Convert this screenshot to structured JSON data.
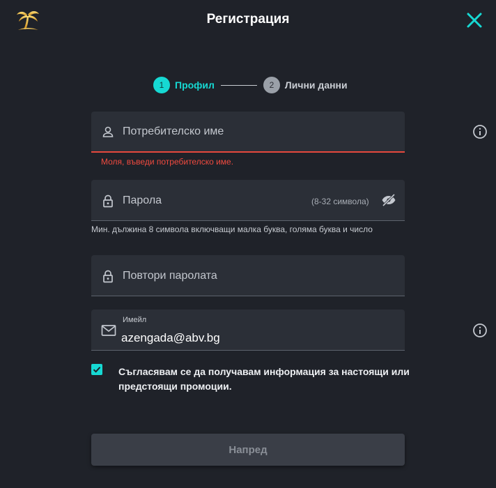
{
  "header": {
    "title": "Регистрация",
    "logo_icon": "palm-tree-logo-icon",
    "close_icon": "close-icon",
    "accent_color": "#16d9d3"
  },
  "stepper": {
    "steps": [
      {
        "number": "1",
        "label": "Профил",
        "state": "active"
      },
      {
        "number": "2",
        "label": "Лични данни",
        "state": "inactive"
      }
    ]
  },
  "form": {
    "username": {
      "placeholder": "Потребителско име",
      "error": "Моля, въведи потребителско име.",
      "error_color": "#ef4a3f"
    },
    "password": {
      "placeholder": "Парола",
      "length_hint": "(8-32 символа)",
      "hint": "Мин. дължина 8 символа включващи малка буква, голяма буква и число"
    },
    "repeat_password": {
      "placeholder": "Повтори паролата"
    },
    "email": {
      "label": "Имейл",
      "value": "azengada@abv.bg"
    },
    "consent": {
      "checked": true,
      "text": "Съгласявам се да получавам информация за настоящи или предстоящи промоции."
    },
    "next_button": {
      "label": "Напред"
    }
  }
}
